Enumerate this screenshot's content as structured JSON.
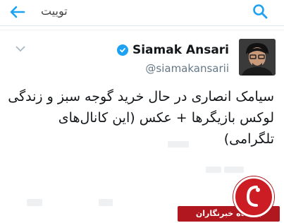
{
  "header": {
    "title": "توییت",
    "back_icon": "arrow-left-icon",
    "search_icon": "search-icon",
    "accent": "#1da1f2"
  },
  "tweet": {
    "display_name": "Siamak Ansari",
    "handle": "@siamakansarii",
    "verified": true,
    "text_line1": "سیامک انصاری در حال خرید گوجه سبز و زندگی",
    "text_line2": "لوکس بازیگرها + عکس (این کانال‌های تلگرامی)"
  },
  "watermark": {
    "label": "باشگاه خبرنگاران",
    "color": "#b0171f"
  }
}
